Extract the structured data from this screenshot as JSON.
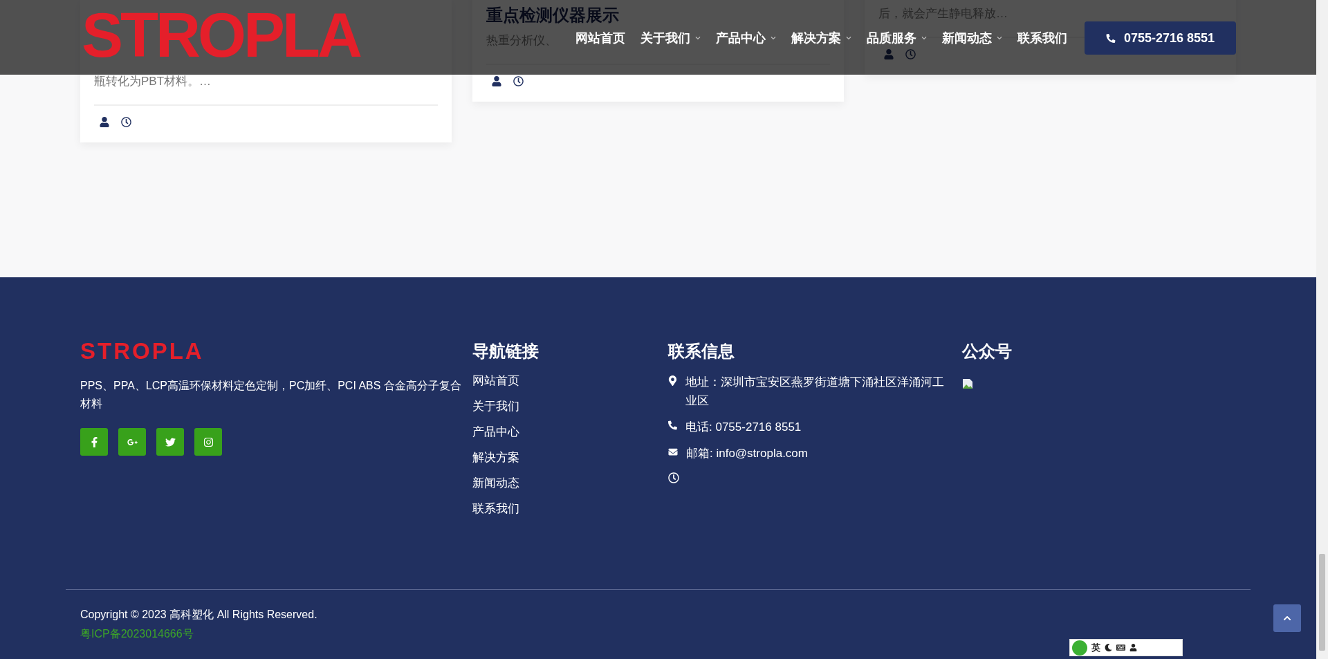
{
  "header": {
    "logo": "STROPLA",
    "nav": [
      {
        "label": "网站首页",
        "has_menu": false
      },
      {
        "label": "关于我们",
        "has_menu": true
      },
      {
        "label": "产品中心",
        "has_menu": true
      },
      {
        "label": "解决方案",
        "has_menu": true
      },
      {
        "label": "品质服务",
        "has_menu": true
      },
      {
        "label": "新闻动态",
        "has_menu": true
      },
      {
        "label": "联系我们",
        "has_menu": false
      }
    ],
    "phone": "0755-2716 8551"
  },
  "cards": [
    {
      "text": "瓶转化为PBT材料。…"
    },
    {
      "title": "重点检测仪器展示",
      "text": "热重分析仪、"
    },
    {
      "text": "后，就会产生静电释放…"
    }
  ],
  "footer": {
    "logo": "STROPLA",
    "description": "PPS、PPA、LCP高温环保材料定色定制，PC加纤、PCI ABS 合金高分子复合材料",
    "nav_title": "导航链接",
    "nav_links": [
      "网站首页",
      "关于我们",
      "产品中心",
      "解决方案",
      "新闻动态",
      "联系我们"
    ],
    "contact_title": "联系信息",
    "contact": [
      {
        "kind": "address",
        "text": "地址：深圳市宝安区燕罗街道塘下涌社区洋涌河工业区"
      },
      {
        "kind": "phone",
        "text": "电话: 0755-2716 8551"
      },
      {
        "kind": "email",
        "text": "邮箱: info@stropla.com"
      },
      {
        "kind": "hours"
      }
    ],
    "wechat_title": "公众号",
    "copyright": "Copyright © 2023 高科塑化 All Rights Reserved.",
    "icp": "粤ICP备2023014666号"
  },
  "ime_toolbar": {
    "language": "英"
  }
}
